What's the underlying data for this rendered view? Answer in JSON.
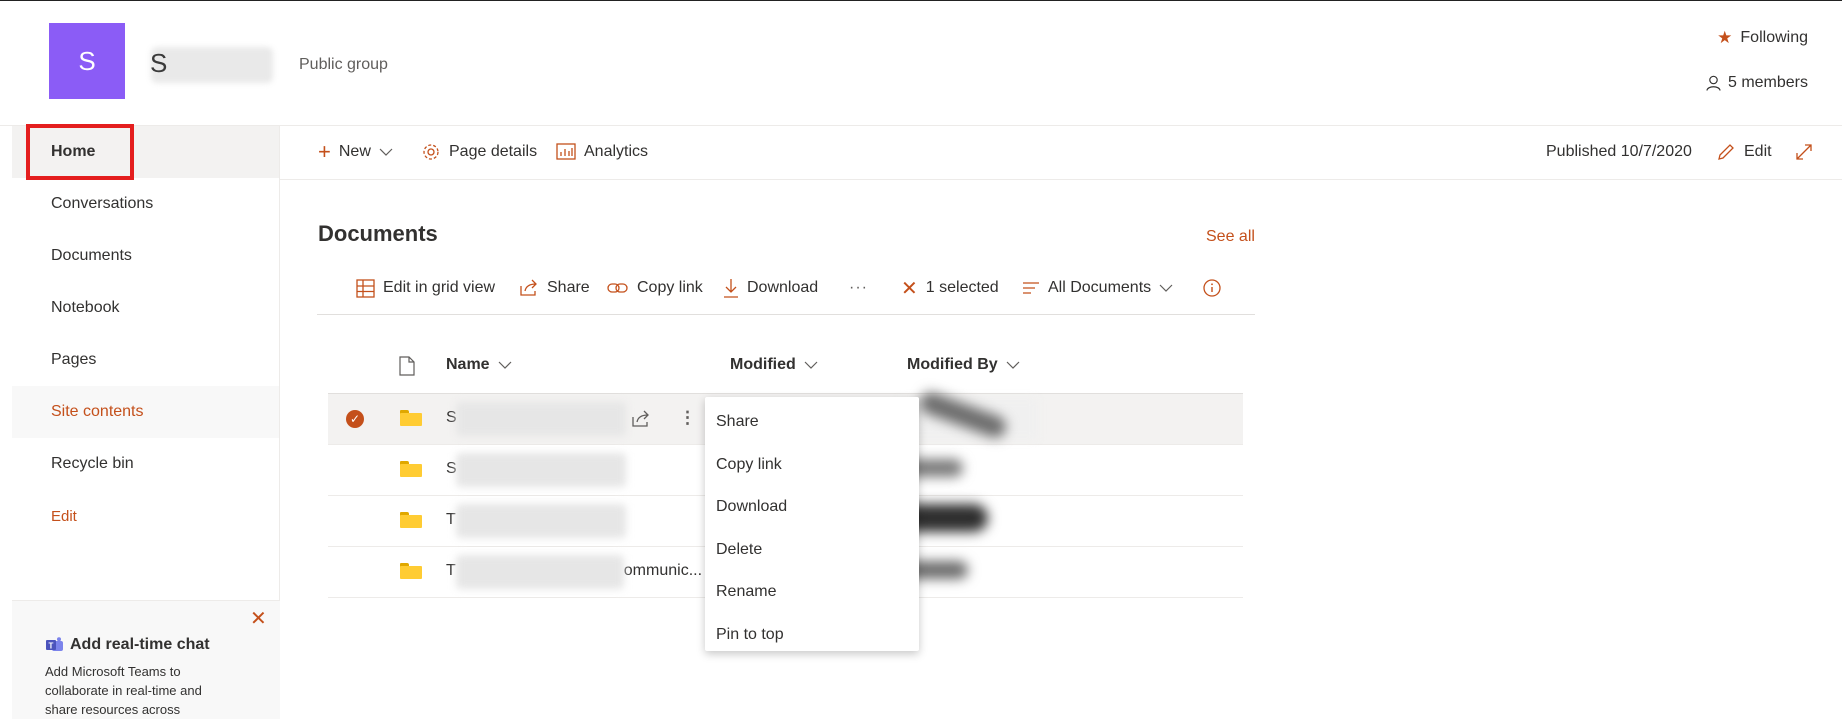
{
  "header": {
    "logo_letter": "S",
    "site_initial": "S",
    "group_type": "Public group",
    "following_label": "Following",
    "members_label": "5 members"
  },
  "leftnav": {
    "items": [
      {
        "label": "Home"
      },
      {
        "label": "Conversations"
      },
      {
        "label": "Documents"
      },
      {
        "label": "Notebook"
      },
      {
        "label": "Pages"
      },
      {
        "label": "Site contents"
      },
      {
        "label": "Recycle bin"
      },
      {
        "label": "Edit"
      }
    ]
  },
  "teams_card": {
    "title": "Add real-time chat",
    "body": "Add Microsoft Teams to collaborate in real-time and share resources across"
  },
  "commandbar": {
    "new_label": "New",
    "page_details_label": "Page details",
    "analytics_label": "Analytics",
    "published_label": "Published 10/7/2020",
    "edit_label": "Edit"
  },
  "documents": {
    "title": "Documents",
    "see_all": "See all",
    "toolbar": {
      "edit_grid": "Edit in grid view",
      "share": "Share",
      "copy_link": "Copy link",
      "download": "Download",
      "more": "···",
      "selected": "1 selected",
      "view": "All Documents"
    },
    "columns": {
      "name": "Name",
      "modified": "Modified",
      "modified_by": "Modified By"
    },
    "rows": [
      {
        "name_prefix": "S",
        "name_suffix": "",
        "selected": true
      },
      {
        "name_prefix": "S",
        "name_suffix": "",
        "selected": false
      },
      {
        "name_prefix": "T",
        "name_suffix": "",
        "selected": false
      },
      {
        "name_prefix": "T",
        "name_suffix": "ommunic...",
        "selected": false
      }
    ]
  },
  "context_menu": {
    "items": [
      "Share",
      "Copy link",
      "Download",
      "Delete",
      "Rename",
      "Pin to top"
    ]
  },
  "colors": {
    "accent": "#c4501b",
    "logo": "#8b5cf6",
    "highlight": "#e41e1e"
  }
}
